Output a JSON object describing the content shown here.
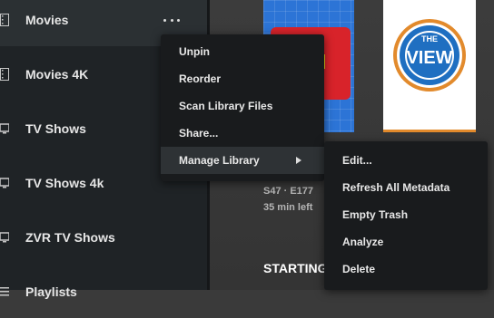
{
  "sidebar": {
    "items": [
      {
        "label": "Movies",
        "icon": "film-icon"
      },
      {
        "label": "Movies 4K",
        "icon": "film-icon"
      },
      {
        "label": "TV Shows",
        "icon": "tv-icon"
      },
      {
        "label": "TV Shows 4k",
        "icon": "tv-icon"
      },
      {
        "label": "ZVR TV Shows",
        "icon": "tv-icon"
      },
      {
        "label": "Playlists",
        "icon": "playlist-icon"
      }
    ],
    "more_icon": "more-dots-icon"
  },
  "context_menu": {
    "items": [
      {
        "label": "Unpin"
      },
      {
        "label": "Reorder"
      },
      {
        "label": "Scan Library Files"
      },
      {
        "label": "Share..."
      },
      {
        "label": "Manage Library",
        "has_submenu": true
      }
    ]
  },
  "submenu": {
    "items": [
      {
        "label": "Edit..."
      },
      {
        "label": "Refresh All Metadata"
      },
      {
        "label": "Empty Trash"
      },
      {
        "label": "Analyze"
      },
      {
        "label": "Delete"
      }
    ]
  },
  "main": {
    "episode_code": "S47 · E177",
    "time_left": "35 min left",
    "section_heading": "STARTING",
    "poster_right_logo": {
      "top": "THE",
      "main": "VIEW"
    }
  },
  "colors": {
    "sidebar_bg": "#1f2326",
    "menu_bg": "#191b1d",
    "menu_hover": "#2e3235",
    "view_blue": "#1f6fc1",
    "view_orange": "#e28a2c"
  }
}
